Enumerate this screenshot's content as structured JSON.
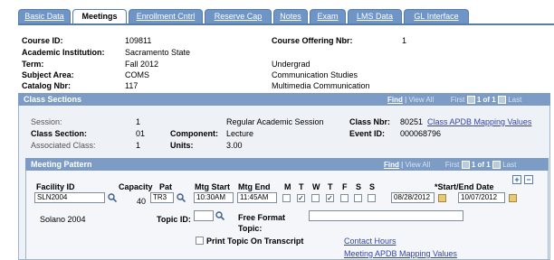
{
  "tabs": [
    "Basic Data",
    "Meetings",
    "Enrollment Cntrl",
    "Reserve Cap",
    "Notes",
    "Exam",
    "LMS Data",
    "GL Interface"
  ],
  "course": {
    "id_label": "Course ID:",
    "id_value": "109811",
    "offering_label": "Course Offering Nbr:",
    "offering_value": "1",
    "institution_label": "Academic Institution:",
    "institution_value": "Sacramento State",
    "term_label": "Term:",
    "term_value": "Fall 2012",
    "career_value": "Undergrad",
    "subject_label": "Subject Area:",
    "subject_value": "COMS",
    "subject_desc": "Communication Studies",
    "catalog_label": "Catalog Nbr:",
    "catalog_value": "117",
    "catalog_desc": "Multimedia Communication"
  },
  "class_sections": {
    "title": "Class Sections",
    "find": "Find",
    "sep": "|",
    "view_all": "View All",
    "first": "First",
    "counter": "1 of 1",
    "last": "Last",
    "session_label": "Session:",
    "session_value": "1",
    "session_desc": "Regular Academic Session",
    "class_nbr_label": "Class Nbr:",
    "class_nbr_value": "80251",
    "apdb_link": "Class APDB Mapping Values",
    "section_label": "Class Section:",
    "section_value": "01",
    "component_label": "Component:",
    "component_value": "Lecture",
    "event_label": "Event ID:",
    "event_value": "000068796",
    "assoc_label": "Associated Class:",
    "assoc_value": "1",
    "units_label": "Units:",
    "units_value": "3.00"
  },
  "meeting_pattern": {
    "title": "Meeting Pattern",
    "find": "Find",
    "sep": "|",
    "view_all": "View All",
    "first": "First",
    "counter": "1 of 1",
    "last": "Last",
    "facility_label": "Facility ID",
    "facility_value": "SLN2004",
    "facility_desc": "Solano  2004",
    "capacity_label": "Capacity",
    "capacity_value": "40",
    "pat_label": "Pat",
    "pat_value": "TR3",
    "start_label": "Mtg Start",
    "start_value": "10:30AM",
    "end_label": "Mtg End",
    "end_value": "11:45AM",
    "days": [
      {
        "label": "M",
        "checked": false
      },
      {
        "label": "T",
        "checked": true
      },
      {
        "label": "W",
        "checked": false
      },
      {
        "label": "T",
        "checked": true
      },
      {
        "label": "F",
        "checked": false
      },
      {
        "label": "S",
        "checked": false
      },
      {
        "label": "S",
        "checked": false
      }
    ],
    "dates_label": "*Start/End Date",
    "start_date": "08/28/2012",
    "end_date": "10/07/2012",
    "topic_label": "Topic ID:",
    "topic_value": "",
    "free_format_label": "Free Format",
    "free_format_label2": "Topic:",
    "free_format_value": "",
    "print_topic_label": "Print Topic On Transcript",
    "contact_hours_link": "Contact Hours",
    "meeting_apdb_link": "Meeting APDB Mapping Values"
  },
  "colors": {
    "tab_bg": "#6f95c7",
    "panel_header": "#7c9cc5",
    "link": "#3344aa"
  }
}
